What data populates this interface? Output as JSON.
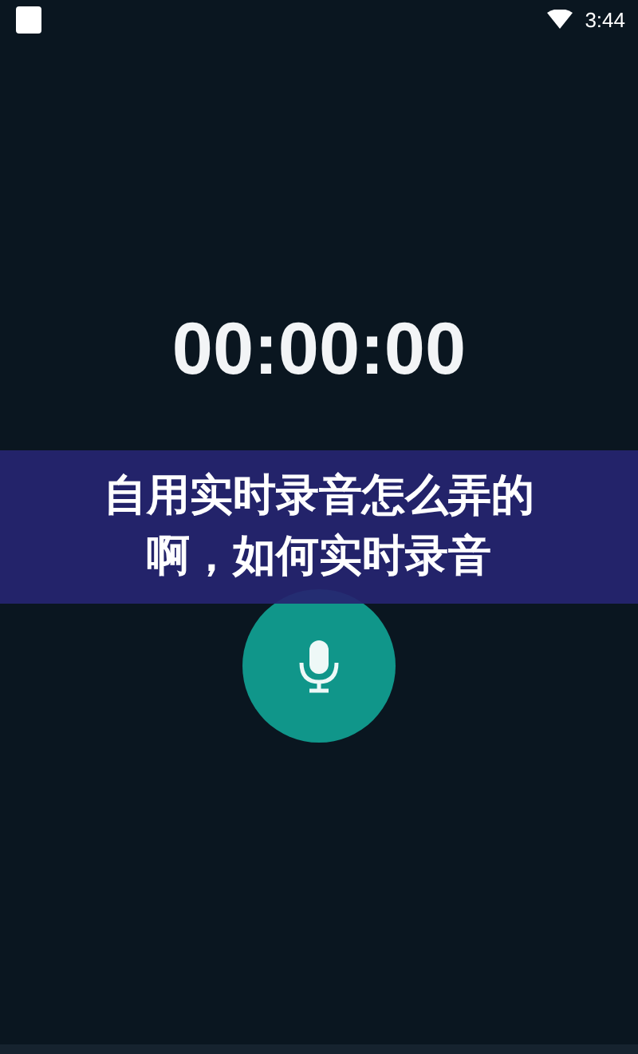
{
  "status_bar": {
    "time": "3:44"
  },
  "timer": "00:00:00",
  "record_button": {
    "recording": false
  },
  "overlay_title": "自用实时录音怎么弄的啊，如何实时录音"
}
